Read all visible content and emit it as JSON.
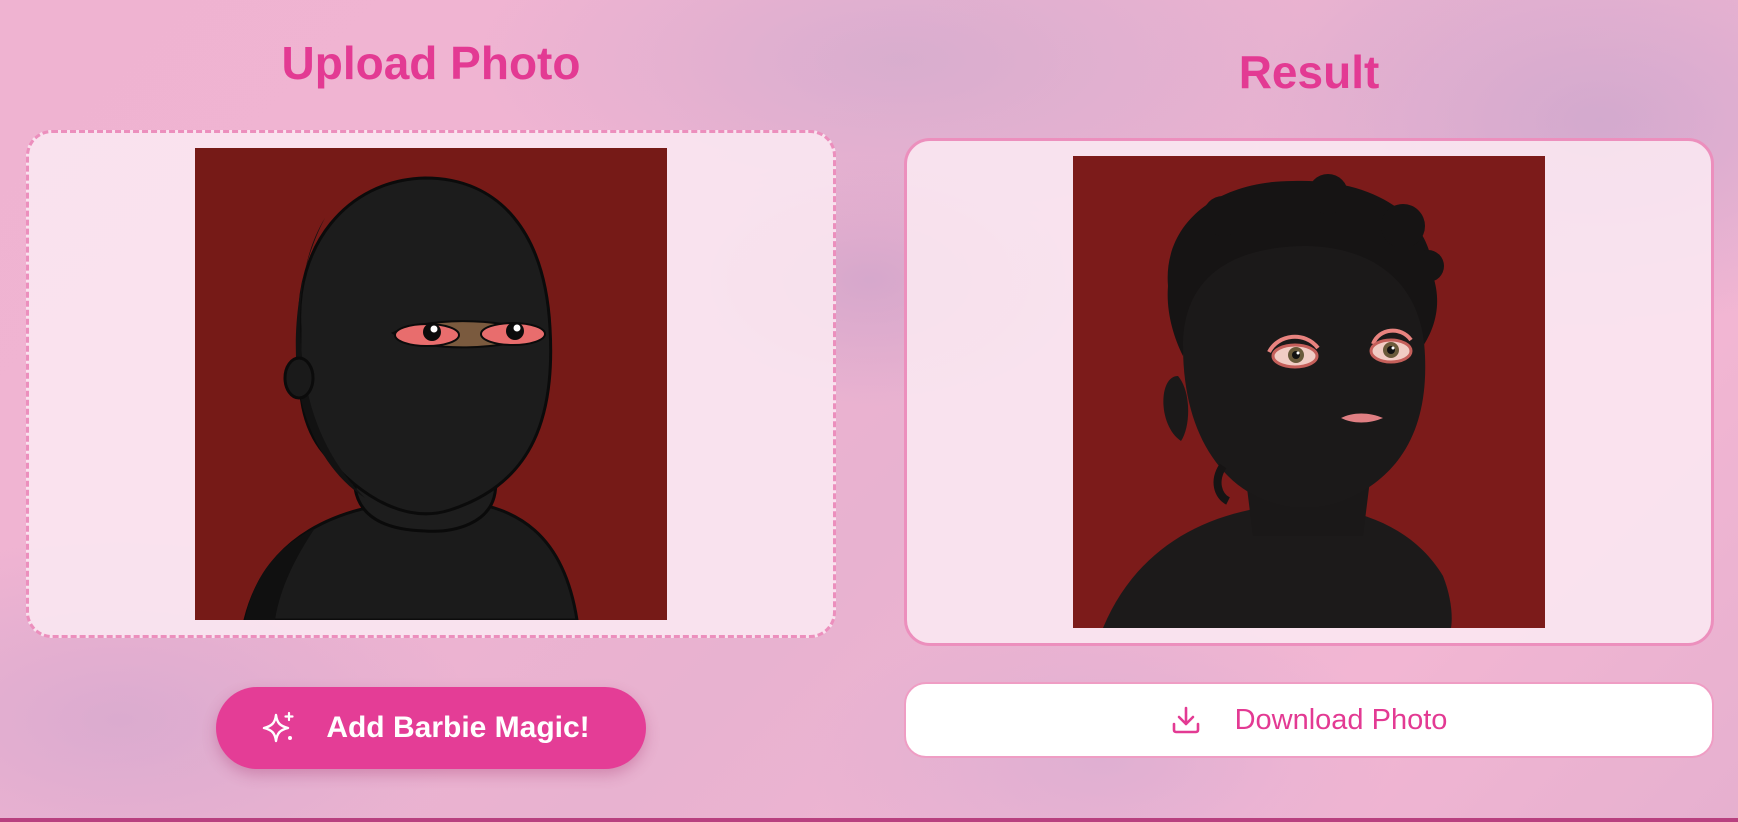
{
  "upload": {
    "title": "Upload Photo",
    "button_label": "Add Barbie Magic!",
    "button_icon": "sparkles-icon"
  },
  "result": {
    "title": "Result",
    "button_label": "Download Photo",
    "button_icon": "download-icon"
  },
  "colors": {
    "accent": "#e43d96",
    "frame_border": "#ec8fbd",
    "photo_background": "#791b18"
  }
}
